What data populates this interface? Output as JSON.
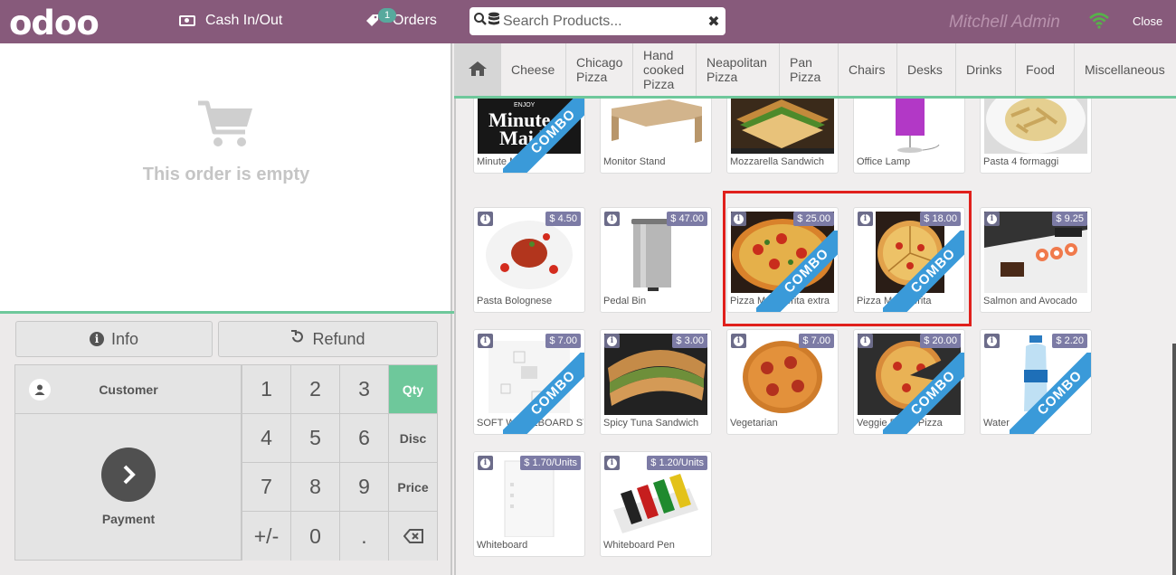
{
  "topbar": {
    "logo": "odoo",
    "cash_label": "Cash In/Out",
    "orders_label": "Orders",
    "orders_count": "1",
    "search_placeholder": "Search Products...",
    "cashier": "Mitchell Admin",
    "close_label": "Close",
    "colors": {
      "brand": "#875a7b",
      "accent": "#6ec89b",
      "wifi": "#57b24a"
    }
  },
  "order": {
    "empty_text": "This order is empty"
  },
  "controls": {
    "info_label": "Info",
    "refund_label": "Refund",
    "customer_label": "Customer",
    "payment_label": "Payment"
  },
  "numpad": {
    "row1": [
      "1",
      "2",
      "3"
    ],
    "row2": [
      "4",
      "5",
      "6"
    ],
    "row3": [
      "7",
      "8",
      "9"
    ],
    "row4": [
      "+/-",
      "0",
      "."
    ],
    "modes": [
      "Qty",
      "Disc",
      "Price"
    ],
    "active_mode": "Qty",
    "backspace_icon": "backspace-icon"
  },
  "categories": [
    {
      "label": "Cheese"
    },
    {
      "label": "Chicago Pizza"
    },
    {
      "label": "Hand cooked Pizza"
    },
    {
      "label": "Neapolitan Pizza"
    },
    {
      "label": "Pan Pizza"
    },
    {
      "label": "Chairs"
    },
    {
      "label": "Desks"
    },
    {
      "label": "Drinks"
    },
    {
      "label": "Food"
    },
    {
      "label": "Miscellaneous"
    }
  ],
  "products": [
    {
      "name": "Minute Maid",
      "price": "",
      "combo": true
    },
    {
      "name": "Monitor Stand",
      "price": "",
      "combo": false
    },
    {
      "name": "Mozzarella Sandwich",
      "price": "",
      "combo": false
    },
    {
      "name": "Office Lamp",
      "price": "",
      "combo": false
    },
    {
      "name": "Pasta 4 formaggi",
      "price": "",
      "combo": false
    },
    {
      "name": "Pasta Bolognese",
      "price": "$ 4.50",
      "combo": false
    },
    {
      "name": "Pedal Bin",
      "price": "$ 47.00",
      "combo": false
    },
    {
      "name": "Pizza Margherita extra",
      "price": "$ 25.00",
      "combo": true
    },
    {
      "name": "Pizza Margherita",
      "price": "$ 18.00",
      "combo": true
    },
    {
      "name": "Salmon and Avocado",
      "price": "$ 9.25",
      "combo": false
    },
    {
      "name": "SOFT WHITEBOARD STAND",
      "price": "$ 7.00",
      "combo": true
    },
    {
      "name": "Spicy Tuna Sandwich",
      "price": "$ 3.00",
      "combo": false
    },
    {
      "name": "Vegetarian",
      "price": "$ 7.00",
      "combo": false
    },
    {
      "name": "Veggie Pasta Pizza",
      "price": "$ 20.00",
      "combo": true
    },
    {
      "name": "Water",
      "price": "$ 2.20",
      "combo": true
    },
    {
      "name": "Whiteboard",
      "price": "$ 1.70/Units",
      "combo": false
    },
    {
      "name": "Whiteboard Pen",
      "price": "$ 1.20/Units",
      "combo": false
    }
  ],
  "combo_label": "COMBO",
  "highlight": {
    "color": "#e0201c"
  }
}
